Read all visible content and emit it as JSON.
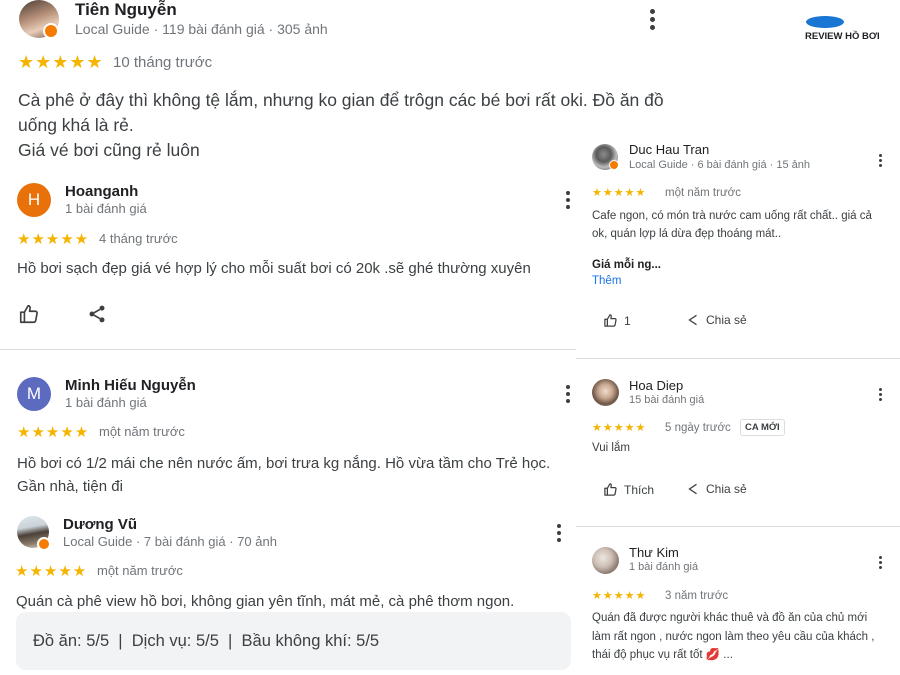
{
  "left_reviews": [
    {
      "name": "Tiên Nguyễn",
      "meta": "Local Guide · 119 bài đánh giá · 305 ảnh",
      "stars": "★★★★★",
      "time": "10 tháng trước",
      "text_lines": [
        "Cà phê ở đây thì không tệ lắm, nhưng ko gian để trôgn các bé bơi rất oki. Đồ ăn đồ",
        "uống khá là rẻ.",
        "Giá vé bơi cũng rẻ luôn"
      ]
    },
    {
      "name": "Hoanganh",
      "avatar_letter": "H",
      "avatar_color": "#e8710a",
      "meta": "1 bài đánh giá",
      "stars": "★★★★★",
      "time": "4 tháng trước",
      "text": "Hồ bơi sạch đẹp giá vé hợp lý cho mỗi suất bơi có 20k .sẽ ghé thường xuyên",
      "like_icon": "thumbs-up-icon",
      "share_icon": "share-icon"
    },
    {
      "name": "Minh Hiếu Nguyễn",
      "avatar_letter": "M",
      "avatar_color": "#5c6bc0",
      "meta": "1 bài đánh giá",
      "stars": "★★★★★",
      "time": "một năm trước",
      "text_lines": [
        "Hồ bơi có 1/2 mái che nên nước ấm, bơi trưa kg nắng. Hồ vừa tầm cho Trẻ học.",
        "Gần nhà, tiện đi"
      ]
    },
    {
      "name": "Dương Vũ",
      "meta": "Local Guide · 7 bài đánh giá · 70 ảnh",
      "stars": "★★★★★",
      "time": "một năm trước",
      "text": "Quán cà phê view hồ bơi, không gian yên tĩnh, mát mẻ, cà phê thơm ngon.",
      "ratings": "Đồ ăn: 5/5  |  Dịch vụ: 5/5  |  Bầu không khí: 5/5"
    }
  ],
  "logo": {
    "text": "REVIEW HỒ BƠI",
    "color": "#1976d2"
  },
  "right_reviews": [
    {
      "name": "Duc Hau Tran",
      "meta": "Local Guide · 6 bài đánh giá · 15 ảnh",
      "stars": "★★★★★",
      "time": "một năm trước",
      "text_lines": [
        "Cafe ngon, có món trà nước cam uống rất chất.. giá cả",
        "ok, quán lợp lá dừa đẹp thoáng mát.."
      ],
      "extra_heading": "Giá mỗi ng...",
      "more": "Thêm",
      "like_count": "1",
      "share": "Chia sẻ"
    },
    {
      "name": "Hoa Diep",
      "meta": "15 bài đánh giá",
      "stars": "★★★★★",
      "time": "5 ngày trước",
      "new_badge": "CA MỚI",
      "text": "Vui lắm",
      "like": "Thích",
      "share": "Chia sẻ"
    },
    {
      "name": "Thư Kim",
      "meta": "1 bài đánh giá",
      "stars": "★★★★★",
      "time": "3 năm trước",
      "text_lines": [
        "Quán đã được người khác thuê và đồ ăn của chủ mới",
        "làm rất ngon , nước ngon làm theo yêu cầu của khách ,",
        "thái độ phục vụ rất tốt 💋 ..."
      ]
    }
  ]
}
